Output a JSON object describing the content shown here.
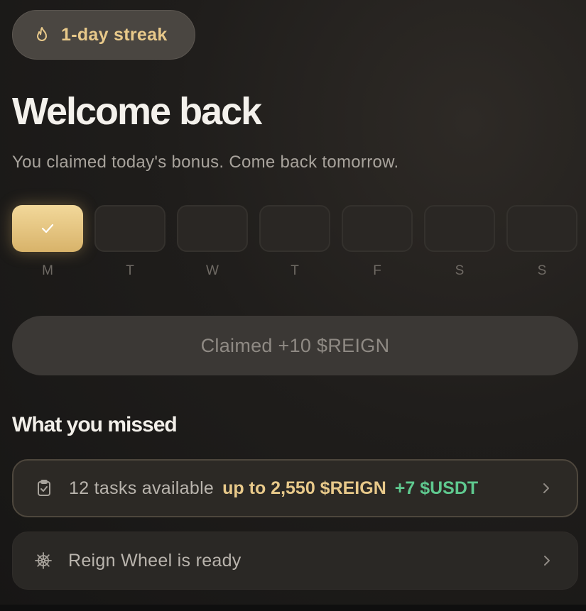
{
  "streak": {
    "label": "1-day streak",
    "icon": "flame-icon"
  },
  "header": {
    "title": "Welcome back",
    "subtitle": "You claimed today's bonus. Come back tomorrow."
  },
  "week": [
    {
      "letter": "M",
      "claimed": true
    },
    {
      "letter": "T",
      "claimed": false
    },
    {
      "letter": "W",
      "claimed": false
    },
    {
      "letter": "T",
      "claimed": false
    },
    {
      "letter": "F",
      "claimed": false
    },
    {
      "letter": "S",
      "claimed": false
    },
    {
      "letter": "S",
      "claimed": false
    }
  ],
  "claim_button": {
    "label": "Claimed +10 $REIGN"
  },
  "missed": {
    "title": "What you missed",
    "tasks": {
      "text": "12 tasks available",
      "reward_reign": "up to 2,550 $REIGN",
      "reward_usdt": "+7 $USDT",
      "icon": "clipboard-check-icon"
    },
    "wheel": {
      "text": "Reign Wheel is ready",
      "icon": "helm-wheel-icon"
    }
  },
  "colors": {
    "accent_gold": "#e8c98a",
    "accent_green": "#5fc98f",
    "background": "#1f1d1b"
  }
}
